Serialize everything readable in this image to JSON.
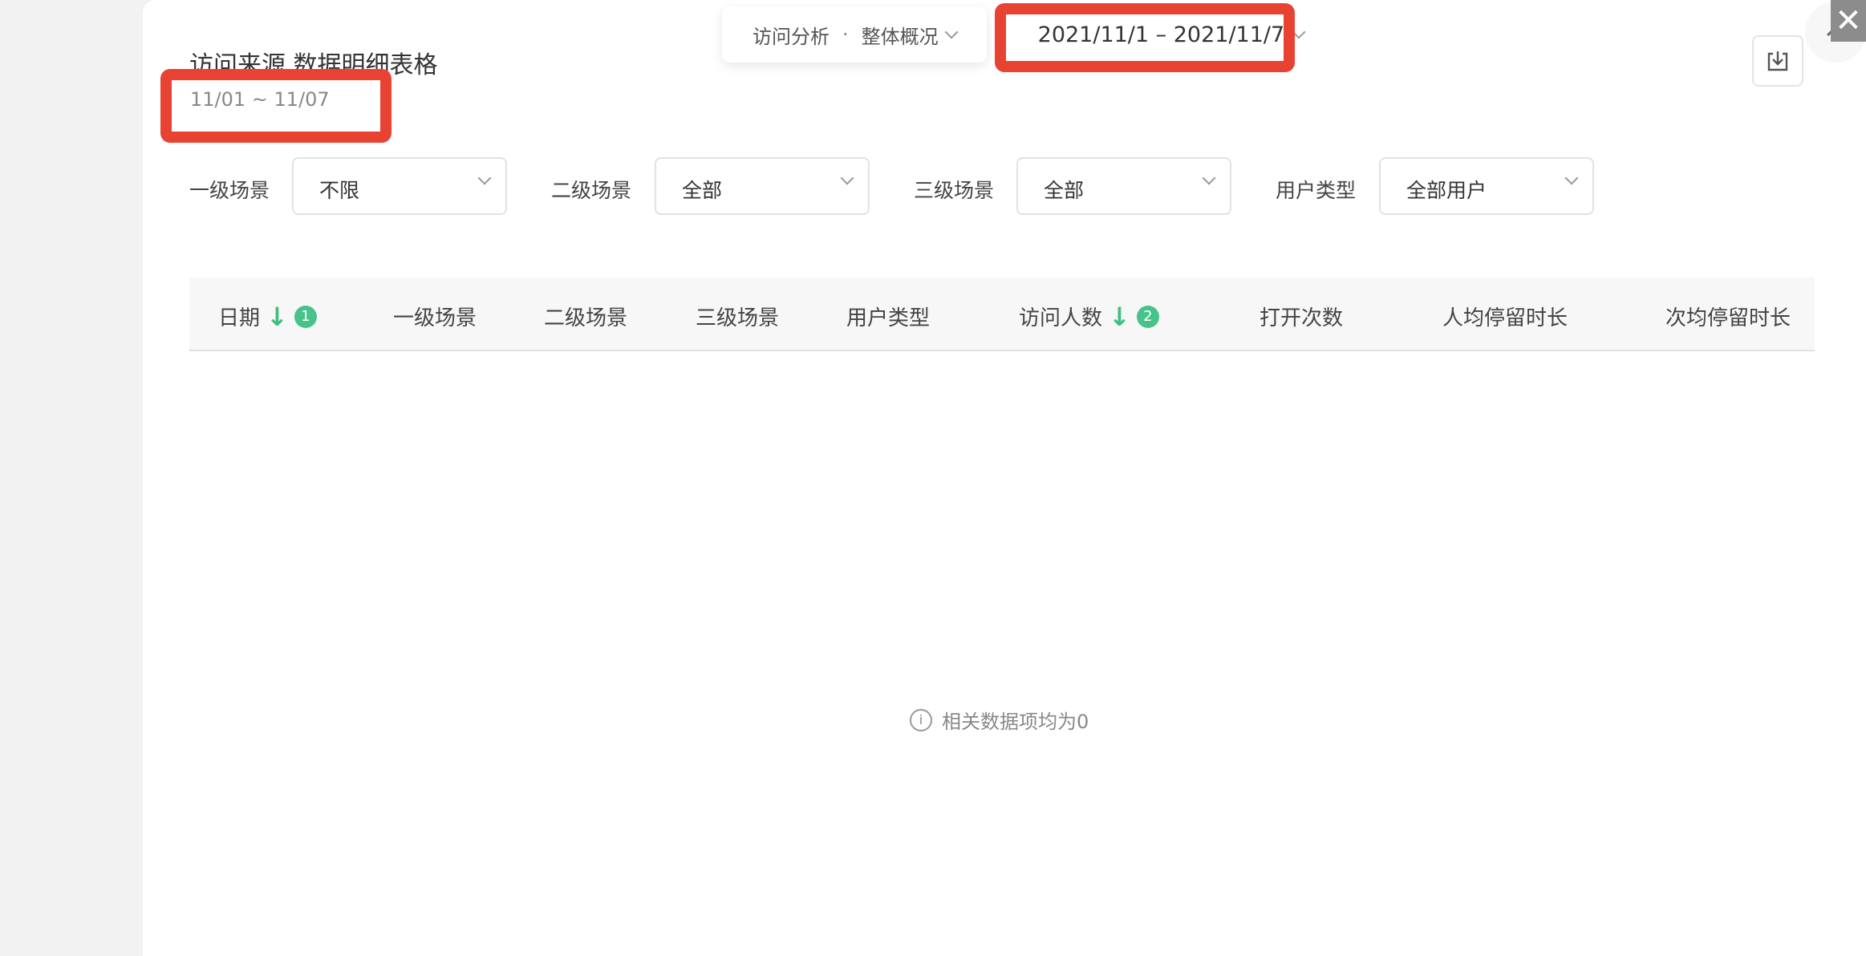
{
  "toolbar": {
    "crumb_a": "访问分析",
    "crumb_sep": "·",
    "crumb_b": "整体概况",
    "date_range": "2021/11/1 – 2021/11/7"
  },
  "header": {
    "title": "访问来源 数据明细表格",
    "subtitle": "11/01 ~ 11/07"
  },
  "filters": [
    {
      "label": "一级场景",
      "value": "不限"
    },
    {
      "label": "二级场景",
      "value": "全部"
    },
    {
      "label": "三级场景",
      "value": "全部"
    },
    {
      "label": "用户类型",
      "value": "全部用户"
    }
  ],
  "table": {
    "columns": [
      {
        "label": "日期",
        "sort_badge": "1"
      },
      {
        "label": "一级场景"
      },
      {
        "label": "二级场景"
      },
      {
        "label": "三级场景"
      },
      {
        "label": "用户类型"
      },
      {
        "label": "访问人数",
        "sort_badge": "2"
      },
      {
        "label": "打开次数"
      },
      {
        "label": "人均停留时长"
      },
      {
        "label": "次均停留时长"
      }
    ],
    "sort_arrow": "↓",
    "empty_text": "相关数据项均为0"
  },
  "icons": {
    "download": "download-icon",
    "close": "close-icon",
    "collapse": "chevron-up-icon",
    "info": "info-icon"
  },
  "colors": {
    "highlight": "#e84332",
    "sort_accent": "#3fbf7f"
  }
}
